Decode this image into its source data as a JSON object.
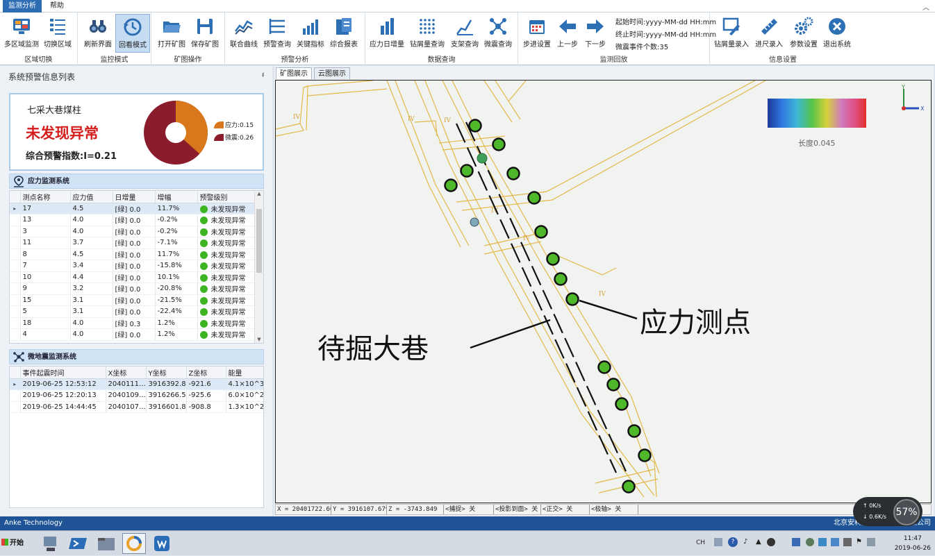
{
  "menubar": {
    "tabs": [
      {
        "label": "监测分析"
      },
      {
        "label": "帮助"
      }
    ]
  },
  "ribbon": {
    "groups": [
      {
        "title": "区域切换",
        "buttons": [
          {
            "label": "多区域监测",
            "icon": "monitor-grid-icon"
          },
          {
            "label": "切换区域",
            "icon": "list-icon"
          }
        ]
      },
      {
        "title": "监控模式",
        "buttons": [
          {
            "label": "刷新界面",
            "icon": "binoculars-icon"
          },
          {
            "label": "回看模式",
            "icon": "history-clock-icon"
          }
        ]
      },
      {
        "title": "矿图操作",
        "buttons": [
          {
            "label": "打开矿图",
            "icon": "folder-open-icon"
          },
          {
            "label": "保存矿图",
            "icon": "save-icon"
          }
        ]
      },
      {
        "title": "预警分析",
        "buttons": [
          {
            "label": "联合曲线",
            "icon": "line-chart-icon"
          },
          {
            "label": "预警查询",
            "icon": "threshold-icon"
          },
          {
            "label": "关键指标",
            "icon": "bar-chart-icon"
          },
          {
            "label": "综合报表",
            "icon": "report-icon"
          }
        ]
      },
      {
        "title": "数据查询",
        "buttons": [
          {
            "label": "应力日增量",
            "icon": "column-chart-icon"
          },
          {
            "label": "钻屑量查询",
            "icon": "dot-matrix-icon"
          },
          {
            "label": "支架查询",
            "icon": "support-chart-icon"
          },
          {
            "label": "微震查询",
            "icon": "network-icon"
          }
        ]
      },
      {
        "title": "监测回放",
        "buttons": [
          {
            "label": "步进设置",
            "icon": "calendar-icon"
          },
          {
            "label": "上一步",
            "icon": "arrow-left-icon"
          },
          {
            "label": "下一步",
            "icon": "arrow-right-icon"
          }
        ]
      },
      {
        "title": "信息设置",
        "buttons": [
          {
            "label": "钻屑量录入",
            "icon": "pen-edit-icon"
          },
          {
            "label": "进尺录入",
            "icon": "ruler-icon"
          },
          {
            "label": "参数设置",
            "icon": "gears-icon"
          },
          {
            "label": "退出系统",
            "icon": "close-circle-icon"
          }
        ]
      }
    ],
    "playback": {
      "start": "起始时间:yyyy-MM-dd HH:mm",
      "end": "终止时间:yyyy-MM-dd HH:mm",
      "count": "微震事件个数:35"
    }
  },
  "left": {
    "title": "系统预警信息列表",
    "summary": {
      "name": "七采大巷煤柱",
      "status": "未发现异常",
      "index": "综合预警指数:I=0.21",
      "legend": [
        {
          "label": "应力:0.15",
          "value": 0.15,
          "color": "#d8771c"
        },
        {
          "label": "微震:0.26",
          "value": 0.26,
          "color": "#8b1c2b"
        }
      ]
    },
    "stress": {
      "title": "应力监测系统",
      "columns": [
        "测点名称",
        "应力值",
        "日增量",
        "增幅",
        "预警级别"
      ],
      "rows": [
        [
          "17",
          "4.5",
          "[绿] 0.0",
          "11.7%",
          "未发现异常"
        ],
        [
          "13",
          "4.0",
          "[绿] 0.0",
          "-0.2%",
          "未发现异常"
        ],
        [
          "3",
          "4.0",
          "[绿] 0.0",
          "-0.2%",
          "未发现异常"
        ],
        [
          "11",
          "3.7",
          "[绿] 0.0",
          "-7.1%",
          "未发现异常"
        ],
        [
          "8",
          "4.5",
          "[绿] 0.0",
          "11.7%",
          "未发现异常"
        ],
        [
          "7",
          "3.4",
          "[绿] 0.0",
          "-15.8%",
          "未发现异常"
        ],
        [
          "10",
          "4.4",
          "[绿] 0.0",
          "10.1%",
          "未发现异常"
        ],
        [
          "9",
          "3.2",
          "[绿] 0.0",
          "-20.8%",
          "未发现异常"
        ],
        [
          "15",
          "3.1",
          "[绿] 0.0",
          "-21.5%",
          "未发现异常"
        ],
        [
          "5",
          "3.1",
          "[绿] 0.0",
          "-22.4%",
          "未发现异常"
        ],
        [
          "18",
          "4.0",
          "[绿] 0.3",
          "1.2%",
          "未发现异常"
        ],
        [
          "4",
          "4.0",
          "[绿] 0.0",
          "1.2%",
          "未发现异常"
        ]
      ]
    },
    "micro": {
      "title": "微地震监测系统",
      "columns": [
        "事件起震时间",
        "X坐标",
        "Y坐标",
        "Z坐标",
        "能量"
      ],
      "rows": [
        [
          "2019-06-25 12:53:12",
          "2040111...",
          "3916392.8",
          "-921.6",
          "4.1×10^3"
        ],
        [
          "2019-06-25 12:20:13",
          "2040109...",
          "3916266.5",
          "-925.6",
          "6.0×10^2"
        ],
        [
          "2019-06-25 14:44:45",
          "2040107...",
          "3916601.8",
          "-908.8",
          "1.3×10^2"
        ]
      ]
    }
  },
  "map": {
    "tabs": [
      {
        "label": "矿图展示"
      },
      {
        "label": "云图展示"
      }
    ],
    "legend_label": "长度0.045",
    "axis_x": "X",
    "axis_y": "Y",
    "annotation_points": "应力测点",
    "annotation_roadway": "待掘大巷",
    "roadway_labels": [
      "IV",
      "IV",
      "IV",
      "IV",
      "IV",
      "IV"
    ],
    "status": {
      "x": "X = 20401722.601",
      "y": "Y = 3916107.679",
      "z": "Z = -3743.849",
      "snap": "<捕捉> 关",
      "proj": "<投影到面> 关",
      "ortho": "<正交> 关",
      "polar": "<极轴> 关"
    }
  },
  "footer": {
    "left": "Anke Technology",
    "right": "北京安科兴业科技股份有限公司"
  },
  "taskbar": {
    "start": "开始",
    "lang": "CH",
    "time": "11:47",
    "date": "2019-06-26"
  },
  "netwidget": {
    "up": "0K/s",
    "down": "0.6K/s",
    "percent": "57%"
  }
}
